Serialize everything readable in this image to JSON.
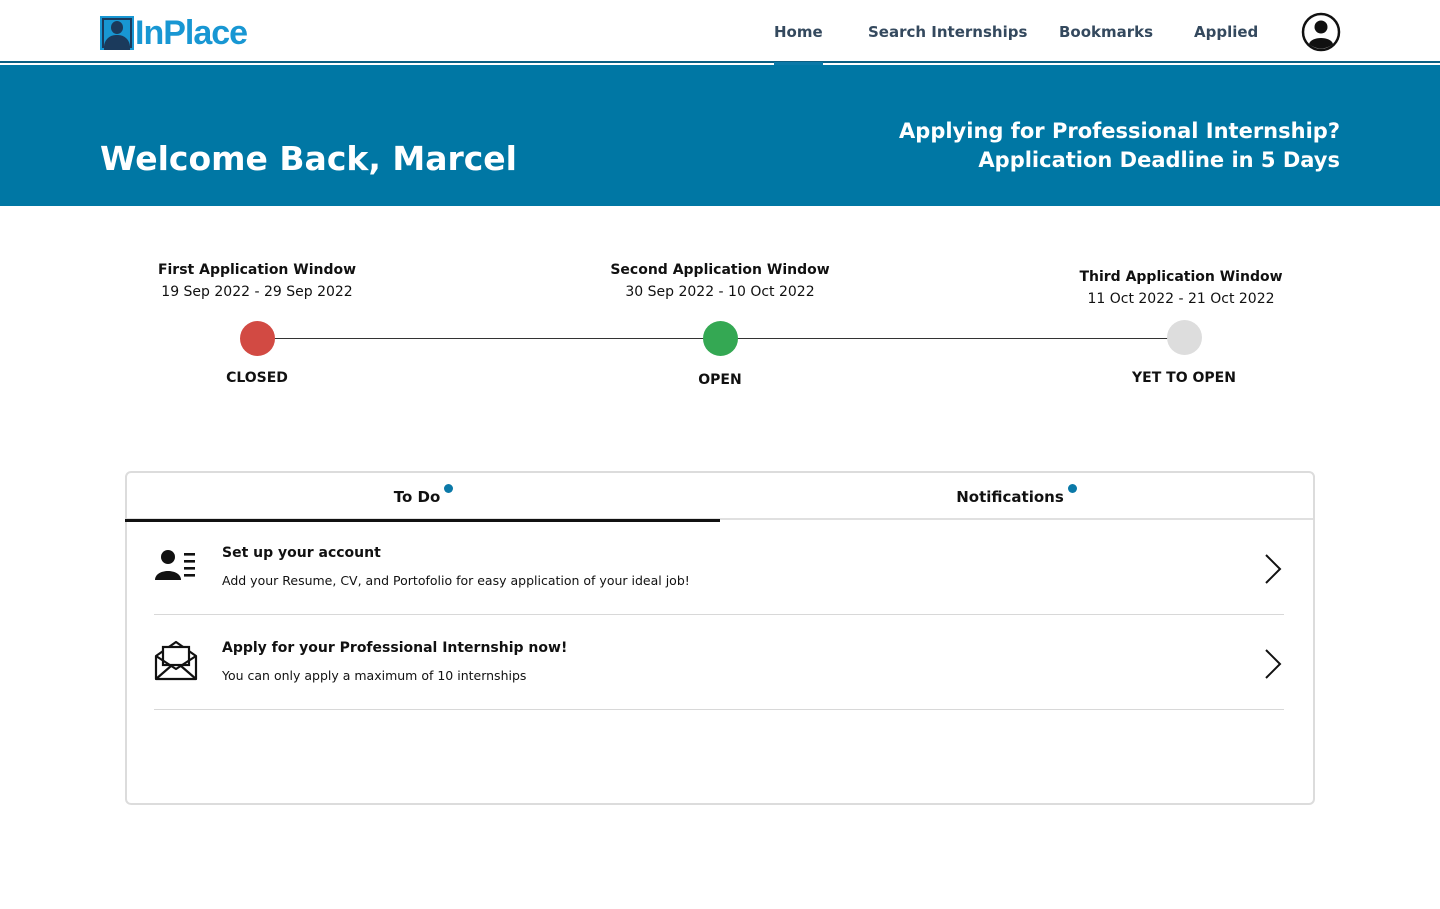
{
  "app": {
    "logo_text": "InPlace"
  },
  "nav": {
    "items": [
      {
        "label": "Home",
        "active": true
      },
      {
        "label": "Search Internships",
        "active": false
      },
      {
        "label": "Bookmarks",
        "active": false
      },
      {
        "label": "Applied",
        "active": false
      }
    ],
    "profile_icon": "user-circle-icon"
  },
  "banner": {
    "welcome": "Welcome Back, Marcel",
    "deadline_line1": "Applying for Professional Internship?",
    "deadline_line2": "Application Deadline in 5 Days"
  },
  "timeline": {
    "windows": [
      {
        "title": "First Application Window",
        "dates": "19 Sep 2022 - 29 Sep 2022",
        "status": "CLOSED",
        "color": "#d24a43"
      },
      {
        "title": "Second Application Window",
        "dates": "30 Sep 2022 - 10 Oct 2022",
        "status": "OPEN",
        "color": "#34a853"
      },
      {
        "title": "Third Application Window",
        "dates": "11 Oct 2022 - 21 Oct 2022",
        "status": "YET TO OPEN",
        "color": "#dddddd"
      }
    ]
  },
  "panel": {
    "tabs": [
      {
        "label": "To Do",
        "active": true,
        "has_dot": true
      },
      {
        "label": "Notifications",
        "active": false,
        "has_dot": true
      }
    ],
    "todo_items": [
      {
        "icon": "account-card-icon",
        "title": "Set up your account",
        "description": "Add your Resume, CV, and Portofolio for easy application of your ideal job!"
      },
      {
        "icon": "open-envelope-icon",
        "title": "Apply for your Professional Internship now!",
        "description": "You can only apply a maximum of 10 internships"
      }
    ]
  },
  "colors": {
    "brand": "#1897d3",
    "banner": "#0077a4",
    "accent": "#0b79a8"
  }
}
